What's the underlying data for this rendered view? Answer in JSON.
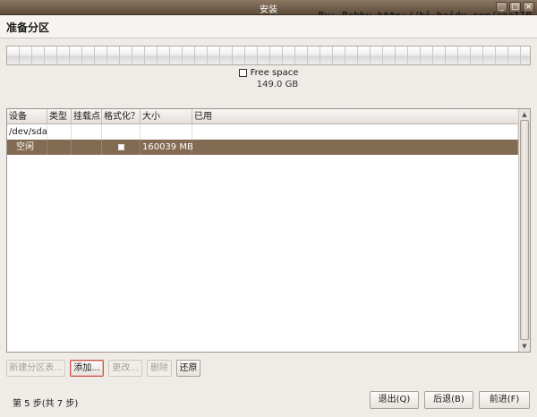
{
  "window": {
    "title": "安装",
    "controls": [
      "_",
      "□",
      "×"
    ]
  },
  "watermark": "By: Bobby http://hi.baidu.com/eao110",
  "page": {
    "title": "准备分区"
  },
  "partition_legend": {
    "label": "Free space",
    "size": "149.0 GB"
  },
  "table": {
    "headers": [
      "设备",
      "类型",
      "挂载点",
      "格式化？",
      "大小",
      "已用"
    ],
    "rows": [
      {
        "device": "/dev/sda",
        "type": "",
        "mount": "",
        "format": "",
        "size": "",
        "used": ""
      },
      {
        "device": "空闲",
        "type": "",
        "mount": "",
        "format": "checkbox",
        "size": "160039 MB",
        "used": ""
      }
    ],
    "selected_row": 1
  },
  "actions": {
    "new_table": "新建分区表...",
    "add": "添加...",
    "change": "更改...",
    "delete": "删除",
    "revert": "还原"
  },
  "footer": {
    "step": "第 5 步(共 7 步)",
    "quit": "退出(Q)",
    "back": "后退(B)",
    "forward": "前进(F)"
  },
  "colors": {
    "selection": "#836b53",
    "titlebar": "#6e5a47",
    "focus_ring": "#c9564a"
  }
}
